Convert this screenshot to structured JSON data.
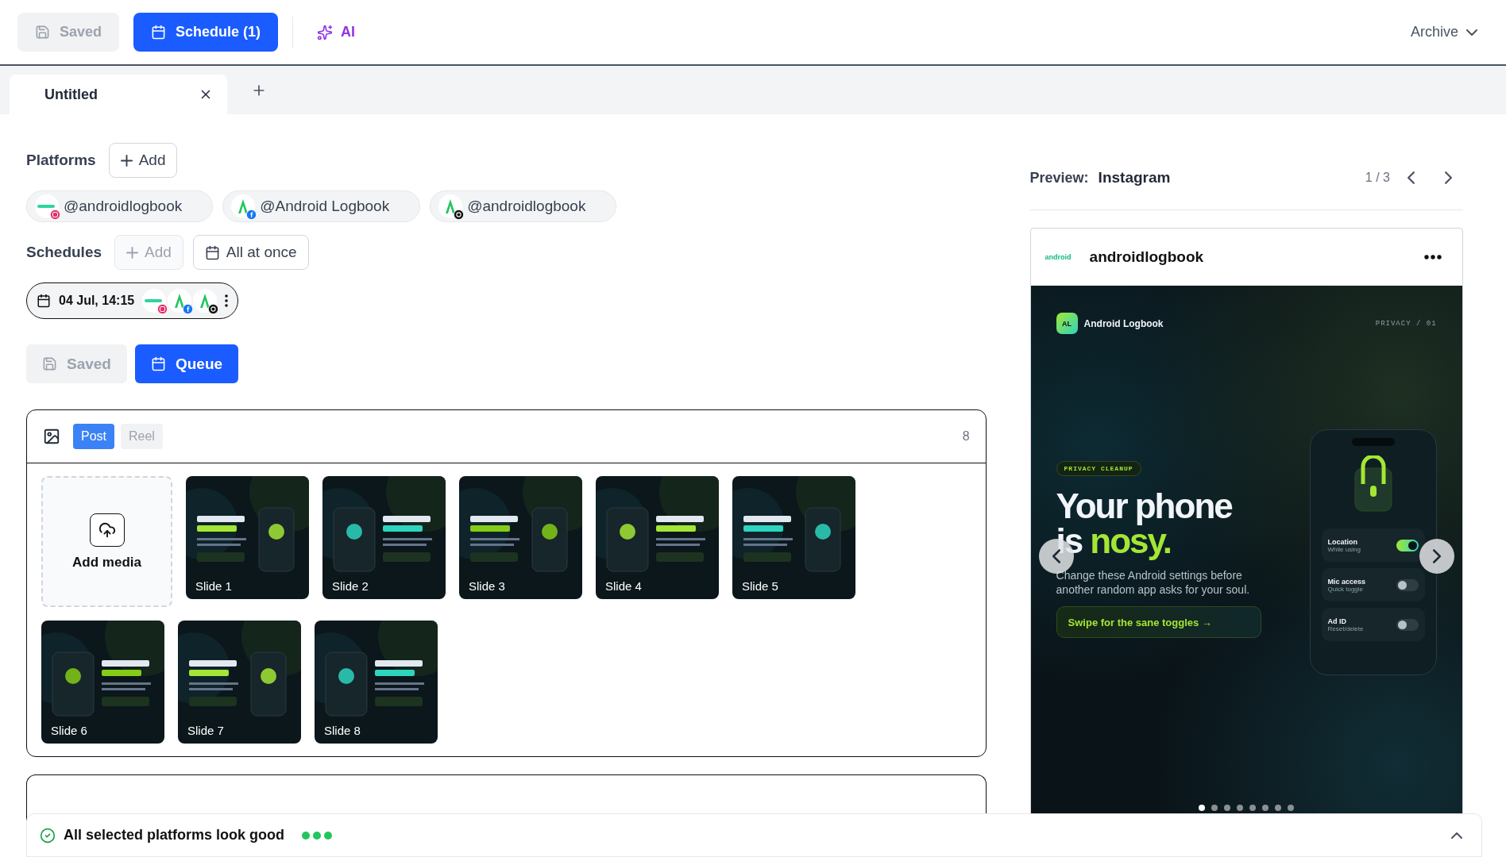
{
  "toolbar": {
    "saved": {
      "label": "Saved",
      "disabled": true
    },
    "schedule": {
      "label": "Schedule (1)",
      "disabled": false
    },
    "ai": {
      "label": "AI"
    },
    "archive": {
      "label": "Archive"
    }
  },
  "tabs": [
    {
      "label": "Untitled",
      "selected": true
    }
  ],
  "platforms": {
    "label": "Platforms",
    "add_button": {
      "label": "Add",
      "disabled": false
    },
    "accounts": [
      {
        "handle": "@androidlogbook",
        "kind": "instagram"
      },
      {
        "handle": "@Android Logbook",
        "kind": "facebook"
      },
      {
        "handle": "@androidlogbook",
        "kind": "threads"
      }
    ]
  },
  "schedules": {
    "label": "Schedules",
    "add_button": {
      "label": "Add",
      "disabled": true
    },
    "mode_button": "All at once",
    "entries": [
      {
        "time": "04 Jul, 14:15",
        "networks": [
          {
            "kind": "instagram"
          },
          {
            "kind": "facebook"
          },
          {
            "kind": "threads"
          }
        ]
      }
    ]
  },
  "actions": [
    {
      "label": "Saved",
      "disabled": true
    },
    {
      "label": "Queue",
      "disabled": false
    }
  ],
  "media": {
    "types": [
      {
        "label": "Post",
        "selected": true
      },
      {
        "label": "Reel",
        "selected": false
      }
    ],
    "count": "8",
    "add_label": "Add media",
    "slides": [
      {
        "label": "Slide 1"
      },
      {
        "label": "Slide 2"
      },
      {
        "label": "Slide 3"
      },
      {
        "label": "Slide 4"
      },
      {
        "label": "Slide 5"
      },
      {
        "label": "Slide 6"
      },
      {
        "label": "Slide 7"
      },
      {
        "label": "Slide 8"
      }
    ]
  },
  "preview": {
    "label": "Preview:",
    "platform": "Instagram",
    "page": "1 / 3",
    "account": "androidlogbook",
    "avatar_text": "android",
    "slide": {
      "badge": "AL",
      "brand": "Android Logbook",
      "tag": "PRIVACY / 01",
      "kicker": "PRIVACY CLEANUP",
      "headline": "Your phone",
      "headline_end": "is",
      "highlight": "nosy.",
      "body": "Change these Android settings before another random app asks for your soul.",
      "cta": "Swipe for the sane toggles →",
      "toggles": [
        {
          "title": "Location",
          "subtitle": "While using",
          "on": true
        },
        {
          "title": "Mic access",
          "subtitle": "Quick toggle",
          "on": false
        },
        {
          "title": "Ad ID",
          "subtitle": "Reset/delete",
          "on": false
        }
      ],
      "dots": [
        {
          "selected": true
        },
        {
          "selected": false
        },
        {
          "selected": false
        },
        {
          "selected": false
        },
        {
          "selected": false
        },
        {
          "selected": false
        },
        {
          "selected": false
        },
        {
          "selected": false
        }
      ]
    }
  },
  "status": {
    "text": "All selected platforms look good"
  }
}
